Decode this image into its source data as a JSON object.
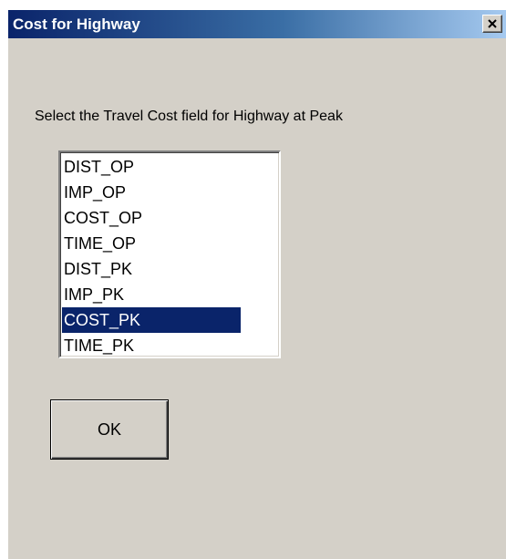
{
  "window": {
    "title": "Cost for Highway"
  },
  "prompt": "Select the Travel Cost field for Highway at Peak",
  "listbox": {
    "items": [
      "DIST_OP",
      "IMP_OP",
      "COST_OP",
      "TIME_OP",
      "DIST_PK",
      "IMP_PK",
      "COST_PK",
      "TIME_PK"
    ],
    "selected": "COST_PK"
  },
  "buttons": {
    "ok_label": "OK"
  },
  "colors": {
    "titlebar_start": "#0a246a",
    "titlebar_end": "#a6caf0",
    "dialog_face": "#d4d0c8",
    "selection": "#0a246a"
  },
  "icons": {
    "close": "close-icon",
    "scroll_up": "arrow-up-icon",
    "scroll_down": "arrow-down-icon"
  }
}
